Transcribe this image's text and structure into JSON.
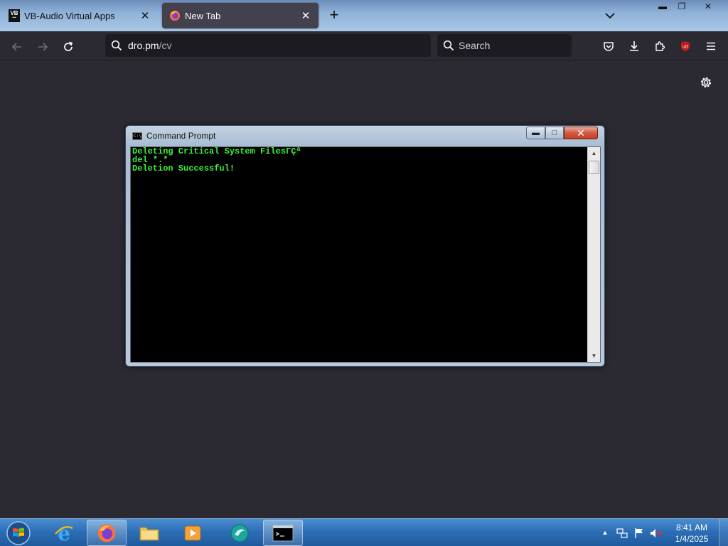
{
  "browser": {
    "tabs": [
      {
        "label": "VB-Audio Virtual Apps",
        "icon": "vb-audio-icon",
        "active": false
      },
      {
        "label": "New Tab",
        "icon": "firefox-icon",
        "active": true
      }
    ],
    "vb_icon_text_top": "VB",
    "vb_icon_text_bottom": "▪▪▪",
    "close_glyph": "✕",
    "new_tab_glyph": "+",
    "window_controls": {
      "minimize": "▬",
      "maximize": "❐",
      "close": "✕"
    },
    "url": {
      "domain": "dro.pm",
      "path": "/cv"
    },
    "search_placeholder": "Search",
    "colors": {
      "toolbar": "#2b2a33",
      "urlbar": "#1c1b22",
      "text": "#fbfbfe"
    }
  },
  "cmd": {
    "title": "Command Prompt",
    "icon_text": "C:\\",
    "controls": {
      "minimize": "▬",
      "maximize": "□",
      "close": "✕"
    },
    "lines": [
      "Deleting Critical System FilesΓÇª",
      "del *.*",
      "Deletion Successful!"
    ],
    "scroll_up_glyph": "▲",
    "scroll_down_glyph": "▼",
    "text_color": "#3cf23c"
  },
  "taskbar": {
    "tray_arrow": "▲",
    "time": "8:41 AM",
    "date": "1/4/2025"
  }
}
